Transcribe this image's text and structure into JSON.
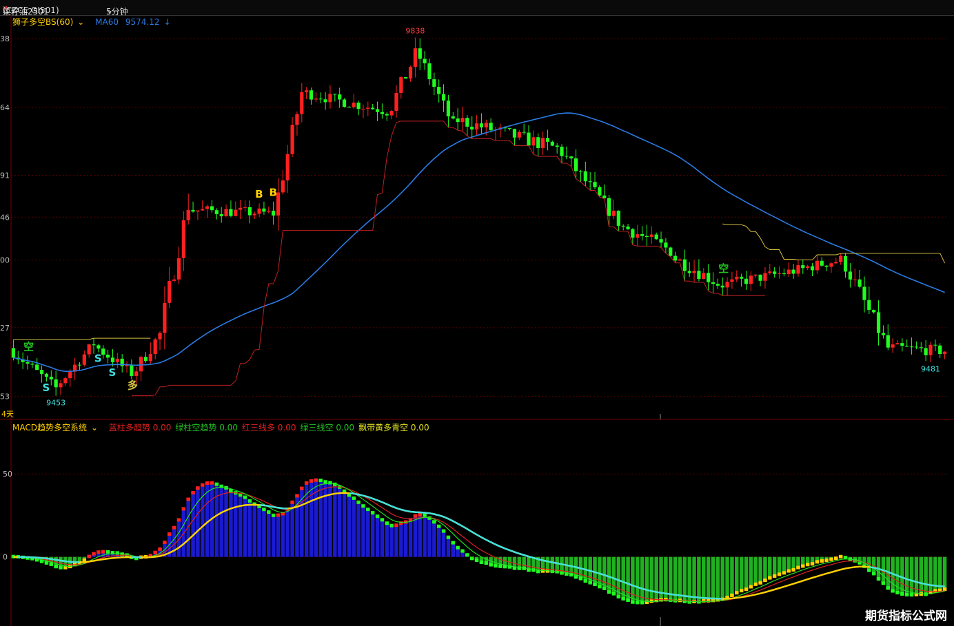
{
  "window": {
    "symbol": "菜籽油2501",
    "symbol_sup": "M",
    "code": "(CZCE OI501)",
    "period": "5分钟"
  },
  "main_panel": {
    "indicator": "狮子多空BS(60)",
    "ma_label": "MA60",
    "ma_value": "9574.12",
    "days_label": "4天",
    "y_ticks": [
      "38",
      "64",
      "91",
      "46",
      "00",
      "27",
      "53"
    ]
  },
  "sub_panel": {
    "indicator": "MACD趋势多空系统",
    "legend": [
      {
        "label": "蓝柱多趋势",
        "value": "0.00",
        "color": "#e02020"
      },
      {
        "label": "绿柱空趋势",
        "value": "0.00",
        "color": "#20c020"
      },
      {
        "label": "红三线多",
        "value": "0.00",
        "color": "#e02020"
      },
      {
        "label": "绿三线空",
        "value": "0.00",
        "color": "#20c020"
      },
      {
        "label": "飘带黄多青空",
        "value": "0.00",
        "color": "#e0e020"
      }
    ],
    "y_ticks": [
      "50",
      "0"
    ]
  },
  "watermark": "期货指标公式网",
  "colors": {
    "up": "#ff2020",
    "down": "#20ff20",
    "ma": "#2a7be4",
    "stop": "#d4c040",
    "bluebar": "#1a1ad0",
    "grid": "#5a0000",
    "cyan": "#40e0e0"
  },
  "chart_data": {
    "type": "candlestick",
    "price_ylim": [
      9435,
      9850
    ],
    "high_label": "9838",
    "low_label_left": "9453",
    "low_label_right": "9481",
    "segments": [
      {
        "n": 10,
        "target": 9462,
        "vol": 4
      },
      {
        "n": 8,
        "target": 9510,
        "vol": 4
      },
      {
        "n": 8,
        "target": 9478,
        "vol": 4
      },
      {
        "n": 6,
        "target": 9520,
        "vol": 5
      },
      {
        "n": 6,
        "target": 9660,
        "vol": 8
      },
      {
        "n": 18,
        "target": 9650,
        "vol": 4
      },
      {
        "n": 6,
        "target": 9780,
        "vol": 7
      },
      {
        "n": 18,
        "target": 9760,
        "vol": 4
      },
      {
        "n": 6,
        "target": 9820,
        "vol": 6
      },
      {
        "n": 8,
        "target": 9745,
        "vol": 5
      },
      {
        "n": 22,
        "target": 9720,
        "vol": 5
      },
      {
        "n": 14,
        "target": 9635,
        "vol": 5
      },
      {
        "n": 10,
        "target": 9610,
        "vol": 5
      },
      {
        "n": 10,
        "target": 9575,
        "vol": 5
      },
      {
        "n": 18,
        "target": 9590,
        "vol": 4
      },
      {
        "n": 8,
        "target": 9600,
        "vol": 4
      },
      {
        "n": 10,
        "target": 9505,
        "vol": 6
      },
      {
        "n": 12,
        "target": 9502,
        "vol": 4
      }
    ],
    "signals": [
      {
        "text": "S",
        "bar": 7,
        "color": "#40e0e0"
      },
      {
        "text": "S",
        "bar": 18,
        "color": "#40e0e0"
      },
      {
        "text": "S",
        "bar": 21,
        "color": "#40e0e0"
      },
      {
        "text": "多",
        "bar": 25,
        "color": "#d4c040"
      },
      {
        "text": "B",
        "bar": 52,
        "color": "#ffd000"
      },
      {
        "text": "B",
        "bar": 55,
        "color": "#ffd000"
      },
      {
        "text": "空",
        "bar": 150,
        "color": "#20c020"
      },
      {
        "text": "空",
        "bar": 3,
        "color": "#20c020"
      }
    ],
    "macd_ylim": [
      -40,
      75
    ]
  }
}
